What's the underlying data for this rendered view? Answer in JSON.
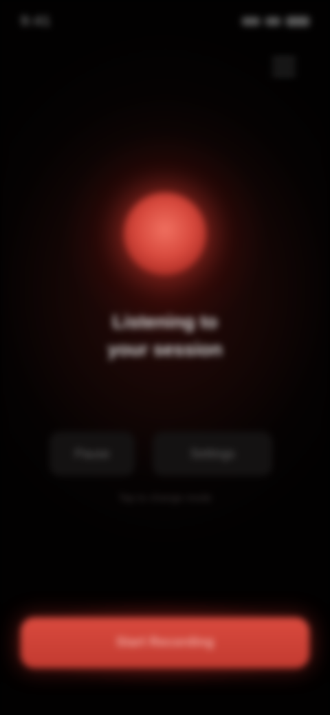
{
  "status_bar": {
    "time": "9:41"
  },
  "headline": {
    "line1": "Listening to",
    "line2": "your session"
  },
  "subline": "",
  "options": [
    {
      "label": "Pause"
    },
    {
      "label": "Settings"
    }
  ],
  "helper_text": "Tap to change mode",
  "cta": {
    "label": "Start Recording"
  },
  "colors": {
    "accent": "#d84a3e",
    "background": "#050202"
  },
  "icons": {
    "signal": "signal-icon",
    "wifi": "wifi-icon",
    "battery": "battery-icon",
    "menu": "menu-icon"
  }
}
